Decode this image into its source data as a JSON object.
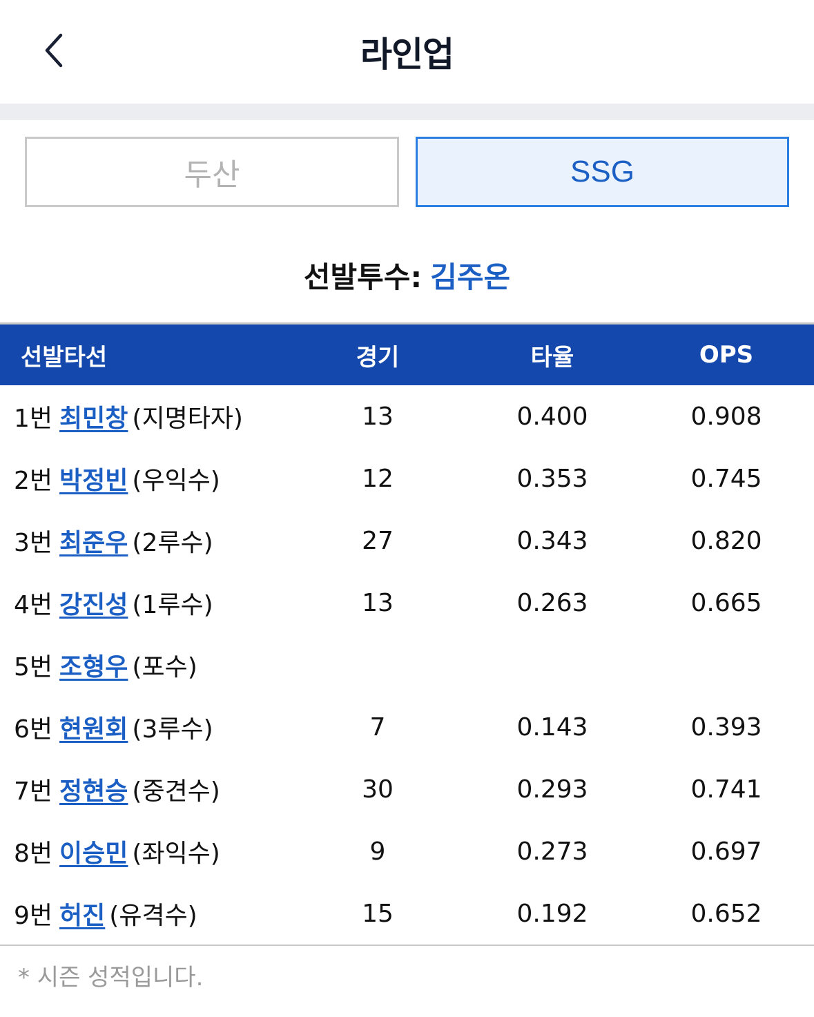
{
  "header": {
    "title": "라인업",
    "back_icon": "chevron-left-icon"
  },
  "tabs": [
    {
      "label": "두산",
      "selected": false
    },
    {
      "label": "SSG",
      "selected": true
    }
  ],
  "pitcher": {
    "label": "선발투수:",
    "name": "김주온"
  },
  "table": {
    "columns": [
      "선발타선",
      "경기",
      "타율",
      "OPS"
    ],
    "rows": [
      {
        "order": "1번",
        "name": "최민창",
        "position": "(지명타자)",
        "games": "13",
        "avg": "0.400",
        "ops": "0.908"
      },
      {
        "order": "2번",
        "name": "박정빈",
        "position": "(우익수)",
        "games": "12",
        "avg": "0.353",
        "ops": "0.745"
      },
      {
        "order": "3번",
        "name": "최준우",
        "position": "(2루수)",
        "games": "27",
        "avg": "0.343",
        "ops": "0.820"
      },
      {
        "order": "4번",
        "name": "강진성",
        "position": "(1루수)",
        "games": "13",
        "avg": "0.263",
        "ops": "0.665"
      },
      {
        "order": "5번",
        "name": "조형우",
        "position": "(포수)",
        "games": "",
        "avg": "",
        "ops": ""
      },
      {
        "order": "6번",
        "name": "현원회",
        "position": "(3루수)",
        "games": "7",
        "avg": "0.143",
        "ops": "0.393"
      },
      {
        "order": "7번",
        "name": "정현승",
        "position": "(중견수)",
        "games": "30",
        "avg": "0.293",
        "ops": "0.741"
      },
      {
        "order": "8번",
        "name": "이승민",
        "position": "(좌익수)",
        "games": "9",
        "avg": "0.273",
        "ops": "0.697"
      },
      {
        "order": "9번",
        "name": "허진",
        "position": "(유격수)",
        "games": "15",
        "avg": "0.192",
        "ops": "0.652"
      }
    ]
  },
  "footnote": "* 시즌 성적입니다.",
  "colors": {
    "brand_blue": "#1448ad",
    "link_blue": "#1b5fc4",
    "selected_tab_border": "#2a7de1"
  }
}
